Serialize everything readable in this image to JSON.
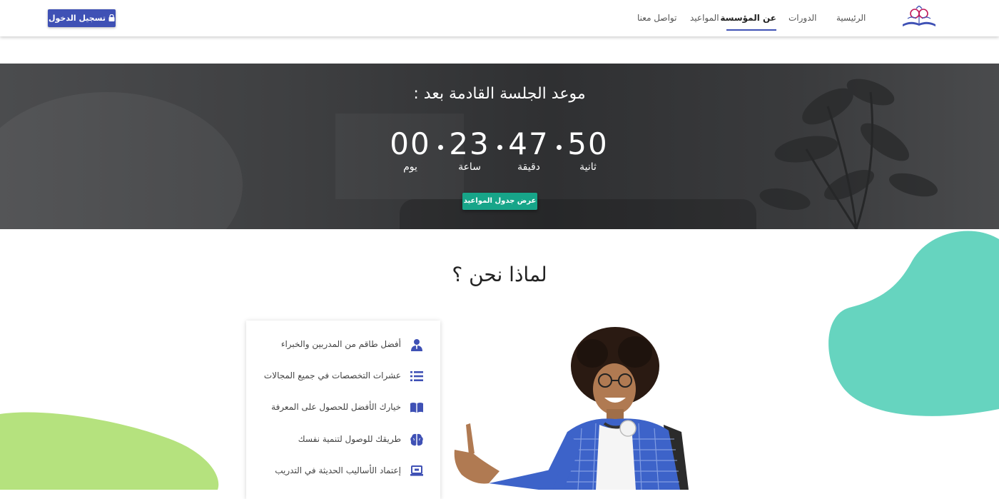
{
  "header": {
    "nav": [
      {
        "label": "الرئيسية",
        "active": false
      },
      {
        "label": "الدورات",
        "active": false
      },
      {
        "label": "عن المؤسسة",
        "active": true
      },
      {
        "label": "المواعيد",
        "active": false
      },
      {
        "label": "تواصل معنا",
        "active": false
      }
    ],
    "login_label": "تسجيل الدخول"
  },
  "hero": {
    "title": "موعد الجلسة القادمة بعد :",
    "countdown": [
      {
        "value": "50",
        "unit": "ثانية"
      },
      {
        "value": "47",
        "unit": "دقيقة"
      },
      {
        "value": "23",
        "unit": "ساعة"
      },
      {
        "value": "00",
        "unit": "يوم"
      }
    ],
    "button_label": "عرض جدول المواعيد"
  },
  "why": {
    "title": "لماذا نحن ؟",
    "features": [
      {
        "icon": "user-tie-icon",
        "text": "أفضل طاقم من المدربين والخبراء"
      },
      {
        "icon": "list-icon",
        "text": "عشرات التخصصات في جميع المجالات"
      },
      {
        "icon": "book-open-icon",
        "text": "خيارك الأفضل للحصول على المعرفة"
      },
      {
        "icon": "brain-icon",
        "text": "طريقك للوصول لتنمية نفسك"
      },
      {
        "icon": "laptop-icon",
        "text": "إعتماد الأساليب الحديثة في التدريب"
      }
    ]
  },
  "colors": {
    "primary": "#3f51b5",
    "accent_teal": "#17a589",
    "blob_teal": "#66d4bf",
    "blob_green": "#b5e27e"
  }
}
